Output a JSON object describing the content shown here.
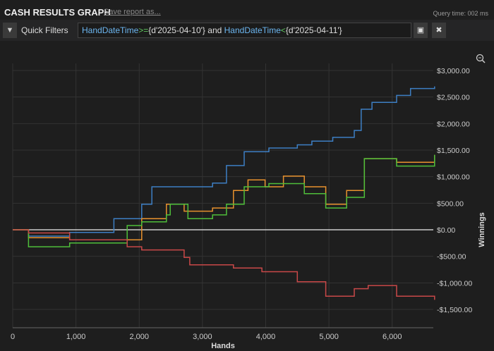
{
  "header": {
    "title": "CASH RESULTS GRAPH",
    "save_link": "Save report as...",
    "query_time": "Query time: 002 ms"
  },
  "filters": {
    "label": "Quick Filters",
    "query": {
      "p1": "HandDateTime",
      "p2": ">=",
      "p3": "{d'2025-04-10'} and ",
      "p4": "HandDateTime",
      "p5": "<",
      "p6": "{d'2025-04-11'}"
    },
    "save_icon": "save-icon",
    "clear_icon": "close-icon"
  },
  "chart_data": {
    "type": "line",
    "title": "",
    "xlabel": "Hands",
    "ylabel": "Winnings",
    "xlim": [
      0,
      6650
    ],
    "ylim": [
      -1700,
      3300
    ],
    "x_ticks": [
      {
        "v": 0,
        "label": "0"
      },
      {
        "v": 1000,
        "label": "1,000"
      },
      {
        "v": 2000,
        "label": "2,000"
      },
      {
        "v": 3000,
        "label": "3,000"
      },
      {
        "v": 4000,
        "label": "4,000"
      },
      {
        "v": 5000,
        "label": "5,000"
      },
      {
        "v": 6000,
        "label": "6,000"
      }
    ],
    "y_ticks": [
      {
        "v": 3000,
        "label": "$3,000.00"
      },
      {
        "v": 2500,
        "label": "$2,500.00"
      },
      {
        "v": 2000,
        "label": "$2,000.00"
      },
      {
        "v": 1500,
        "label": "$1,500.00"
      },
      {
        "v": 1000,
        "label": "$1,000.00"
      },
      {
        "v": 500,
        "label": "$500.00"
      },
      {
        "v": 0,
        "label": "$0.00"
      },
      {
        "v": -500,
        "label": "-$500.00"
      },
      {
        "v": -1000,
        "label": "-$1,000.00"
      },
      {
        "v": -1500,
        "label": "-$1,500.00"
      }
    ],
    "grid": true,
    "series": [
      {
        "name": "blue",
        "color": "#3d7fc4",
        "points": [
          [
            0,
            0
          ],
          [
            250,
            -120
          ],
          [
            900,
            -50
          ],
          [
            1600,
            210
          ],
          [
            2040,
            480
          ],
          [
            2200,
            810
          ],
          [
            2710,
            810
          ],
          [
            3160,
            880
          ],
          [
            3380,
            1210
          ],
          [
            3660,
            1470
          ],
          [
            4050,
            1540
          ],
          [
            4500,
            1600
          ],
          [
            4730,
            1670
          ],
          [
            5060,
            1740
          ],
          [
            5400,
            1870
          ],
          [
            5510,
            2270
          ],
          [
            5680,
            2400
          ],
          [
            6070,
            2530
          ],
          [
            6290,
            2660
          ],
          [
            6670,
            2700
          ]
        ]
      },
      {
        "name": "orange",
        "color": "#e8912d",
        "points": [
          [
            0,
            0
          ],
          [
            250,
            -150
          ],
          [
            900,
            -190
          ],
          [
            1480,
            -190
          ],
          [
            2040,
            210
          ],
          [
            2430,
            480
          ],
          [
            2710,
            350
          ],
          [
            3160,
            410
          ],
          [
            3490,
            740
          ],
          [
            3720,
            940
          ],
          [
            3990,
            810
          ],
          [
            4280,
            1010
          ],
          [
            4610,
            810
          ],
          [
            4950,
            480
          ],
          [
            5280,
            740
          ],
          [
            5560,
            1340
          ],
          [
            6070,
            1270
          ],
          [
            6670,
            1410
          ]
        ]
      },
      {
        "name": "green",
        "color": "#4fbf3a",
        "points": [
          [
            0,
            0
          ],
          [
            250,
            -320
          ],
          [
            900,
            -250
          ],
          [
            1480,
            -250
          ],
          [
            1810,
            80
          ],
          [
            2040,
            150
          ],
          [
            2430,
            280
          ],
          [
            2490,
            480
          ],
          [
            2770,
            210
          ],
          [
            3160,
            280
          ],
          [
            3380,
            480
          ],
          [
            3660,
            810
          ],
          [
            4050,
            870
          ],
          [
            4280,
            870
          ],
          [
            4610,
            680
          ],
          [
            4950,
            410
          ],
          [
            5280,
            610
          ],
          [
            5560,
            1340
          ],
          [
            6070,
            1200
          ],
          [
            6670,
            1410
          ]
        ]
      },
      {
        "name": "red",
        "color": "#c94848",
        "points": [
          [
            0,
            0
          ],
          [
            250,
            -60
          ],
          [
            900,
            -190
          ],
          [
            1810,
            -320
          ],
          [
            2040,
            -380
          ],
          [
            2710,
            -520
          ],
          [
            2800,
            -660
          ],
          [
            3490,
            -720
          ],
          [
            3940,
            -790
          ],
          [
            4500,
            -980
          ],
          [
            4950,
            -1250
          ],
          [
            5400,
            -1110
          ],
          [
            5620,
            -1050
          ],
          [
            6070,
            -1250
          ],
          [
            6670,
            -1320
          ]
        ]
      }
    ]
  }
}
